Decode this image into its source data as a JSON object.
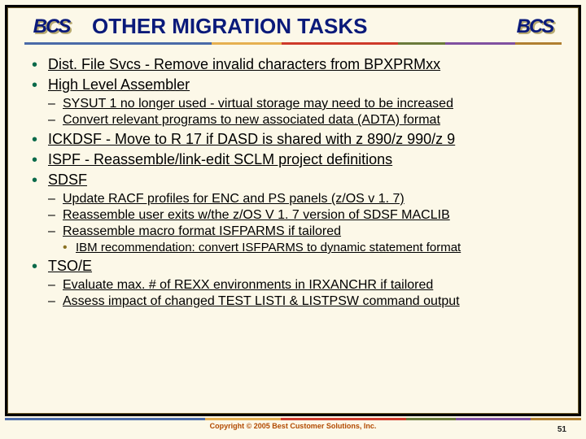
{
  "brand": "BCS",
  "title": "OTHER MIGRATION TASKS",
  "b1": {
    "i0": "Dist. File Svcs - Remove invalid characters from BPXPRMxx",
    "i1": "High Level Assembler",
    "i2": "ICKDSF - Move to R 17 if DASD is shared with z 890/z 990/z 9",
    "i3": "ISPF - Reassemble/link-edit SCLM project definitions",
    "i4": "SDSF",
    "i5": "TSO/E"
  },
  "b2_hla": {
    "i0": "SYSUT 1 no longer used - virtual storage may need to be increased",
    "i1": "Convert relevant programs to new associated data (ADTA) format"
  },
  "b2_sdsf": {
    "i0": "Update RACF profiles for ENC and PS panels (z/OS v 1. 7)",
    "i1": "Reassemble user exits w/the z/OS V 1. 7 version of SDSF MACLIB",
    "i2": "Reassemble macro format ISFPARMS if tailored"
  },
  "b3_sdsf": {
    "i0": "IBM recommendation: convert ISFPARMS to dynamic statement format"
  },
  "b2_tsoe": {
    "i0": "Evaluate max. # of REXX environments in IRXANCHR if tailored",
    "i1": "Assess impact of changed TEST LISTI & LISTPSW command output"
  },
  "footer": {
    "copyright": "Copyright © 2005 Best Customer Solutions, Inc.",
    "page": "51"
  }
}
